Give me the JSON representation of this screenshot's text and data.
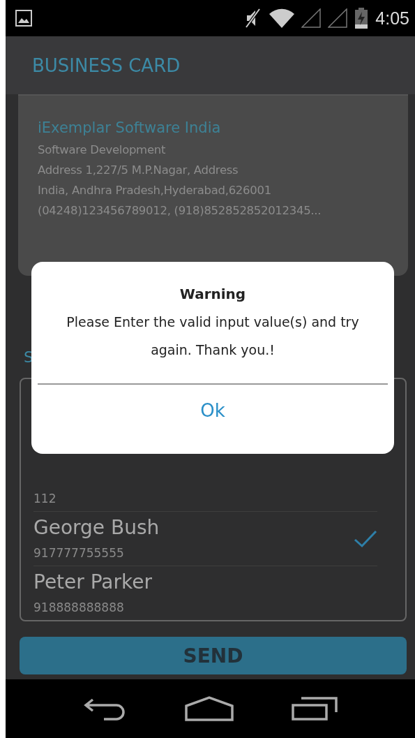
{
  "status_bar": {
    "time": "4:05"
  },
  "app_bar": {
    "title": "BUSINESS CARD"
  },
  "card": {
    "company": "iExemplar Software India",
    "lines": [
      "Software Development",
      "Address 1,227/5 M.P.Nagar, Address",
      "India, Andhra Pradesh,Hyderabad,626001",
      "(04248)123456789012,  (918)852852852012345..."
    ]
  },
  "section": {
    "label": "S"
  },
  "contacts": [
    {
      "number": "112",
      "selected": false
    },
    {
      "name": "George Bush",
      "number": "917777755555",
      "selected": true
    },
    {
      "name": "Peter Parker",
      "number": "918888888888",
      "selected": false
    }
  ],
  "send_button": "SEND",
  "dialog": {
    "title": "Warning",
    "message": "Please Enter the valid input value(s) and try again. Thank you.!",
    "button": "Ok"
  }
}
